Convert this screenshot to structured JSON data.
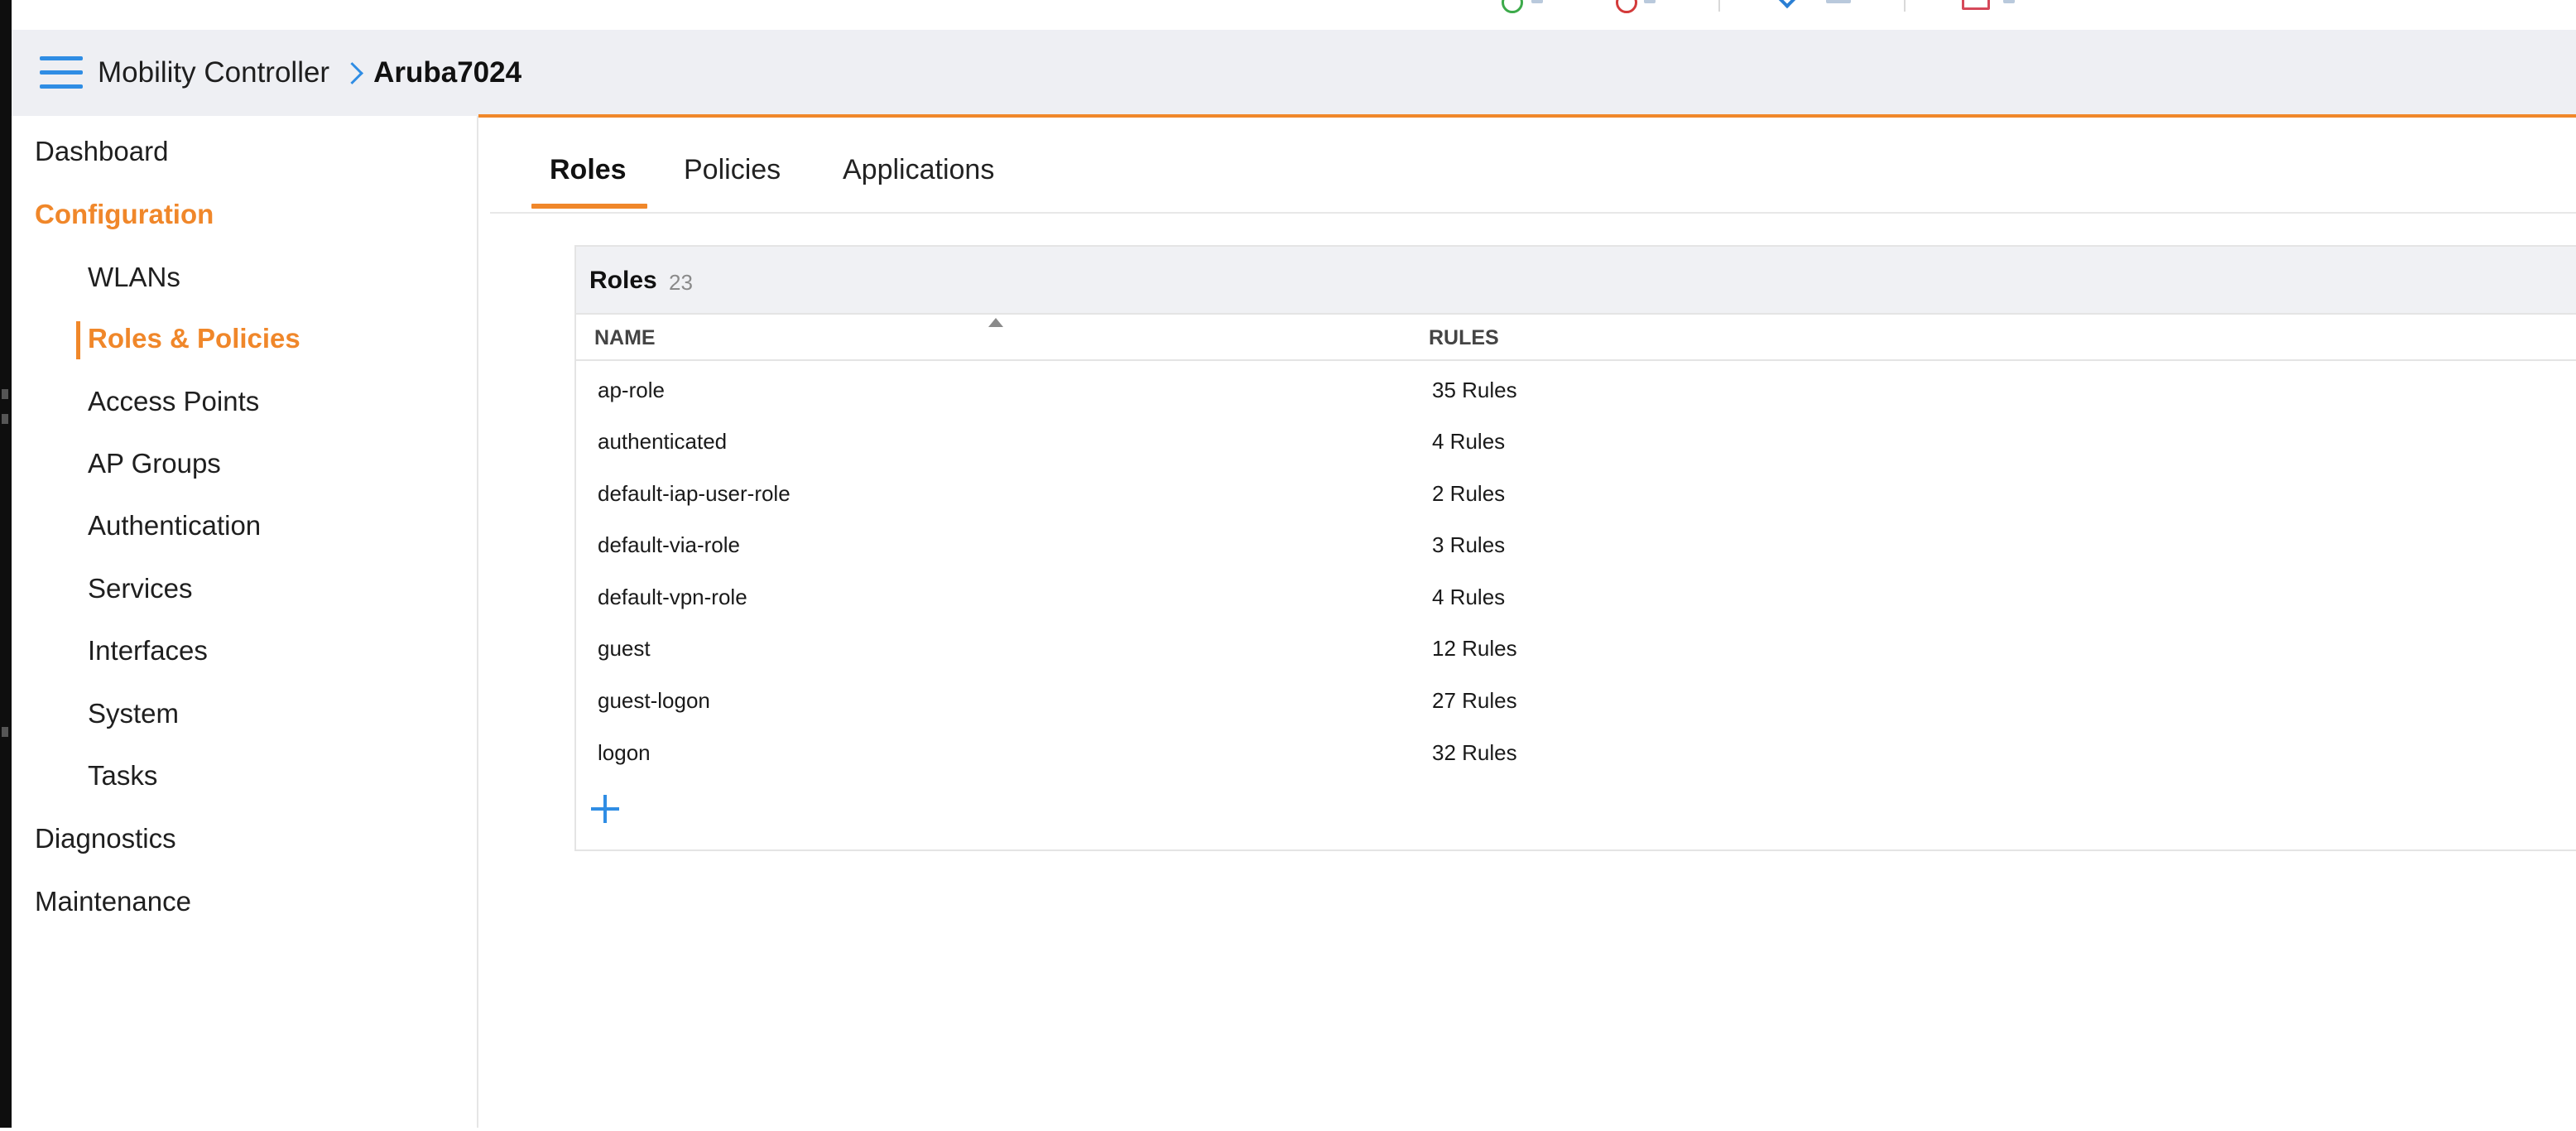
{
  "header": {
    "breadcrumb_root": "Mobility Controller",
    "breadcrumb_current": "Aruba7024"
  },
  "sidebar": {
    "items": [
      {
        "label": "Dashboard"
      },
      {
        "label": "Configuration"
      },
      {
        "label": "WLANs"
      },
      {
        "label": "Roles & Policies"
      },
      {
        "label": "Access Points"
      },
      {
        "label": "AP Groups"
      },
      {
        "label": "Authentication"
      },
      {
        "label": "Services"
      },
      {
        "label": "Interfaces"
      },
      {
        "label": "System"
      },
      {
        "label": "Tasks"
      },
      {
        "label": "Diagnostics"
      },
      {
        "label": "Maintenance"
      }
    ]
  },
  "tabs": [
    {
      "label": "Roles"
    },
    {
      "label": "Policies"
    },
    {
      "label": "Applications"
    }
  ],
  "roles_panel": {
    "title": "Roles",
    "count": "23",
    "columns": {
      "name": "NAME",
      "rules": "RULES"
    },
    "rows": [
      {
        "name": "ap-role",
        "rules": "35 Rules"
      },
      {
        "name": "authenticated",
        "rules": "4 Rules"
      },
      {
        "name": "default-iap-user-role",
        "rules": "2 Rules"
      },
      {
        "name": "default-via-role",
        "rules": "3 Rules"
      },
      {
        "name": "default-vpn-role",
        "rules": "4 Rules"
      },
      {
        "name": "guest",
        "rules": "12 Rules"
      },
      {
        "name": "guest-logon",
        "rules": "27 Rules"
      },
      {
        "name": "logon",
        "rules": "32 Rules"
      }
    ]
  },
  "colors": {
    "accent_orange": "#f0872a",
    "link_blue": "#2f8de4"
  }
}
